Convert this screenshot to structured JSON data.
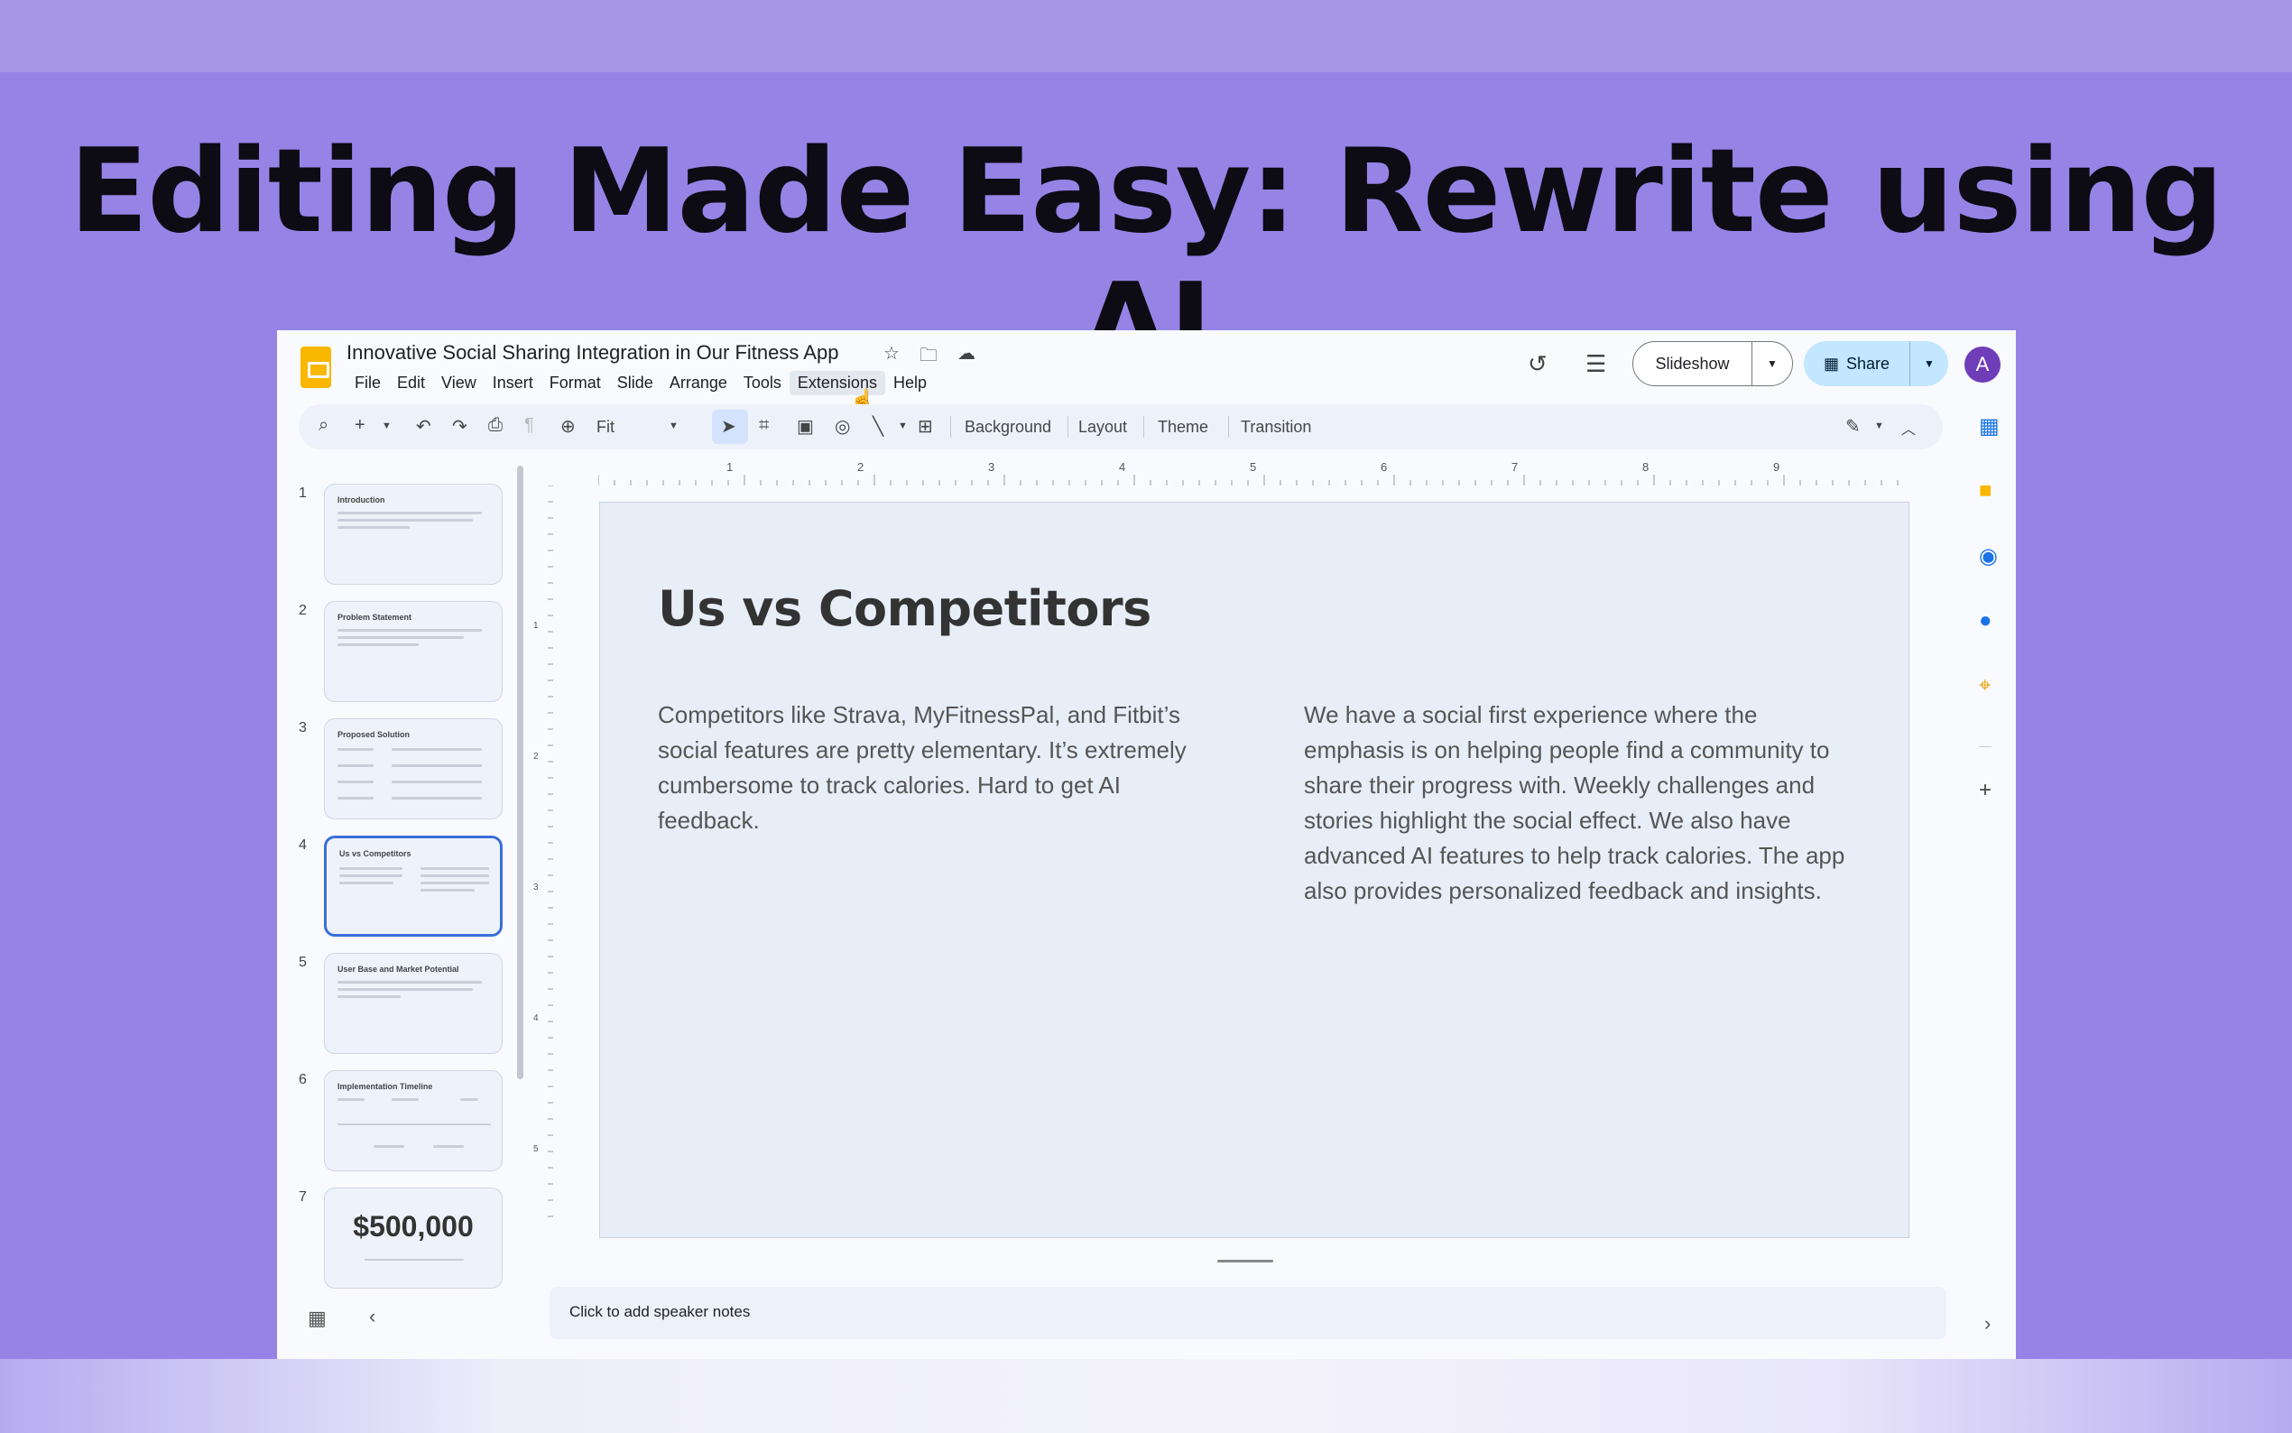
{
  "headline": "Editing Made Easy: Rewrite using AI",
  "app": {
    "doc_title": "Innovative Social Sharing Integration in Our Fitness App",
    "title_icons": [
      "star-icon",
      "folder-move-icon",
      "cloud-saved-icon"
    ],
    "menu": [
      "File",
      "Edit",
      "View",
      "Insert",
      "Format",
      "Slide",
      "Arrange",
      "Tools",
      "Extensions",
      "Help"
    ],
    "active_menu": "Extensions",
    "slideshow_label": "Slideshow",
    "share_label": "Share",
    "avatar_letter": "A",
    "toolbar": {
      "zoom": "Fit",
      "background_label": "Background",
      "layout_label": "Layout",
      "theme_label": "Theme",
      "transition_label": "Transition"
    },
    "ruler_h": [
      "1",
      "2",
      "3",
      "4",
      "5",
      "6",
      "7",
      "8",
      "9"
    ],
    "ruler_v": [
      "1",
      "2",
      "3",
      "4",
      "5"
    ],
    "thumbnails": [
      {
        "num": "1",
        "title": "Introduction"
      },
      {
        "num": "2",
        "title": "Problem Statement"
      },
      {
        "num": "3",
        "title": "Proposed Solution"
      },
      {
        "num": "4",
        "title": "Us vs Competitors"
      },
      {
        "num": "5",
        "title": "User Base and Market Potential"
      },
      {
        "num": "6",
        "title": "Implementation Timeline"
      },
      {
        "num": "7",
        "big": "$500,000"
      }
    ],
    "selected_slide": 4,
    "slide": {
      "title": "Us vs Competitors",
      "left_text": "Competitors like Strava, MyFitnessPal, and Fitbit’s social features are pretty elementary. It’s extremely cumbersome to track calories. Hard to get AI feedback.",
      "right_text": "We have a social first experience where the emphasis is on helping people find a community to share their progress with. Weekly challenges and stories highlight the social effect. We also have advanced AI features to help track calories. The app also provides personalized feedback and insights."
    },
    "notes_placeholder": "Click to add speaker notes",
    "side_panel_icons": [
      "calendar-icon",
      "keep-icon",
      "tasks-icon",
      "contacts-icon",
      "maps-icon",
      "add-icon"
    ]
  },
  "colors": {
    "background": "#9584e6",
    "accent": "#c2e7ff",
    "slide_bg": "#e8eef8",
    "logo": "#f9b700",
    "avatar": "#6f3db8"
  }
}
